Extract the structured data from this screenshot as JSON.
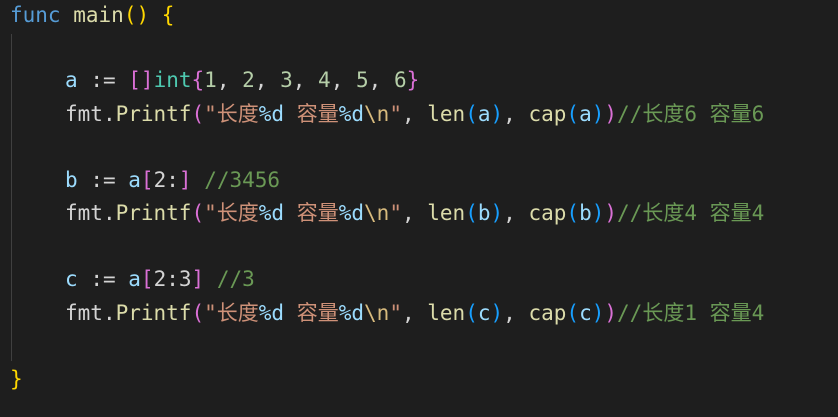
{
  "code": {
    "l1": {
      "kw": "func",
      "fn": "main",
      "lp": "(",
      "rp": ")",
      "lb": "{"
    },
    "l3": {
      "var": "a",
      "op": ":=",
      "lbr": "[",
      "rbr": "]",
      "type": "int",
      "lb": "{",
      "nums": [
        "1",
        "2",
        "3",
        "4",
        "5",
        "6"
      ],
      "rb": "}"
    },
    "l4": {
      "pkg": "fmt",
      "fn": "Printf",
      "s1": "\"长度",
      "f1": "%d",
      "s2": " 容量",
      "f2": "%d",
      "esc": "\\n",
      "s3": "\"",
      "len": "len",
      "cap": "cap",
      "arg": "a",
      "comment": "//长度6 容量6"
    },
    "l6": {
      "var": "b",
      "op": ":=",
      "src": "a",
      "lbr": "[",
      "slice": "2:",
      "rbr": "]",
      "comment": "//3456"
    },
    "l7": {
      "pkg": "fmt",
      "fn": "Printf",
      "s1": "\"长度",
      "f1": "%d",
      "s2": " 容量",
      "f2": "%d",
      "esc": "\\n",
      "s3": "\"",
      "len": "len",
      "cap": "cap",
      "arg": "b",
      "comment": "//长度4 容量4"
    },
    "l9": {
      "var": "c",
      "op": ":=",
      "src": "a",
      "lbr": "[",
      "slice": "2:3",
      "rbr": "]",
      "comment": "//3"
    },
    "l10": {
      "pkg": "fmt",
      "fn": "Printf",
      "s1": "\"长度",
      "f1": "%d",
      "s2": " 容量",
      "f2": "%d",
      "esc": "\\n",
      "s3": "\"",
      "len": "len",
      "cap": "cap",
      "arg": "c",
      "comment": "//长度1 容量4"
    },
    "l12": {
      "rb": "}"
    }
  },
  "colors": {
    "background": "#1e1e1e",
    "keyword": "#569cd6",
    "function": "#dcdcaa",
    "variable": "#9cdcfe",
    "type": "#4ec9b0",
    "number": "#b5cea8",
    "string": "#ce9178",
    "comment": "#6a9955"
  }
}
